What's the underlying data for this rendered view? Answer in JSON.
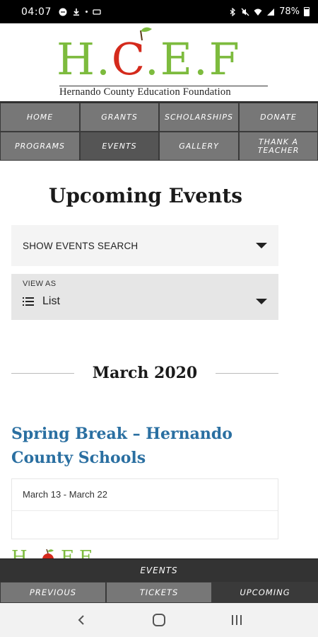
{
  "status_bar": {
    "time": "04:07",
    "battery_pct": "78%",
    "left_icons": [
      "chat-bubble-icon",
      "download-icon",
      "dot-icon",
      "nfc-icon"
    ],
    "right_icons": [
      "bluetooth-icon",
      "mute-icon",
      "wifi-icon",
      "signal-icon",
      "battery-icon"
    ]
  },
  "header": {
    "logo_letters": [
      "H",
      ".",
      "C",
      ".",
      "E",
      ".",
      "F"
    ],
    "logo_tagline": "Hernando County Education Foundation",
    "brand_green": "#7dbb3e",
    "brand_red": "#d42a1c"
  },
  "nav": {
    "items": [
      {
        "label": "HOME"
      },
      {
        "label": "GRANTS"
      },
      {
        "label": "SCHOLARSHIPS"
      },
      {
        "label": "DONATE"
      },
      {
        "label": "PROGRAMS"
      },
      {
        "label": "EVENTS"
      },
      {
        "label": "GALLERY"
      },
      {
        "label": "THANK A TEACHER"
      }
    ]
  },
  "main": {
    "title": "Upcoming Events",
    "search_toggle": "SHOW EVENTS SEARCH",
    "view_as": {
      "label": "VIEW AS",
      "value": "List"
    },
    "month": "March 2020",
    "event": {
      "title": "Spring Break – Hernando County Schools",
      "date": "March 13 - March 22",
      "title_color": "#2a6fa1"
    }
  },
  "bottom_bar": {
    "title": "EVENTS",
    "tabs": [
      {
        "label": "PREVIOUS"
      },
      {
        "label": "TICKETS"
      },
      {
        "label": "UPCOMING"
      }
    ]
  },
  "android_nav": {
    "buttons": [
      "back-icon",
      "home-icon",
      "recents-icon"
    ]
  }
}
